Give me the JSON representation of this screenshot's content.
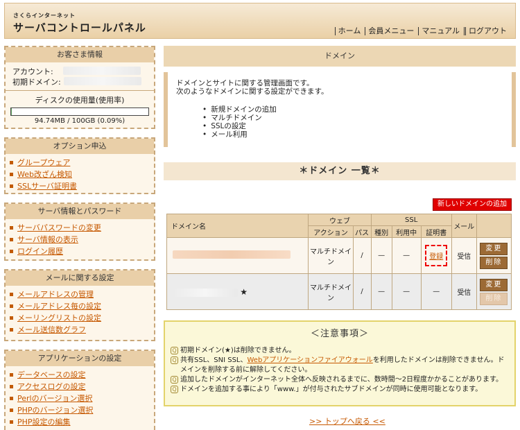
{
  "header": {
    "logo_sub": "さくらインターネット",
    "logo_main": "サーバコントロールパネル",
    "nav": [
      "ホーム",
      "会員メニュー",
      "マニュアル",
      "ログアウト"
    ]
  },
  "sidebar": {
    "customer": {
      "title": "お客さま情報",
      "account_label": "アカウント:",
      "domain_label": "初期ドメイン:",
      "disk_label": "ディスクの使用量(使用率)",
      "disk_value": "94.74MB / 100GB (0.09%)",
      "disk_usage_fraction": 0.0009
    },
    "options": {
      "title": "オプション申込",
      "items": [
        "グループウェア",
        "Web改ざん検知",
        "SSLサーバ証明書"
      ]
    },
    "server": {
      "title": "サーバ情報とパスワード",
      "items": [
        "サーバパスワードの変更",
        "サーバ情報の表示",
        "ログイン履歴"
      ]
    },
    "mail": {
      "title": "メールに関する設定",
      "items": [
        "メールアドレスの管理",
        "メールアドレス毎の設定",
        "メーリングリストの設定",
        "メール送信数グラフ"
      ]
    },
    "apps": {
      "title": "アプリケーションの設定",
      "items": [
        "データベースの設定",
        "アクセスログの設定",
        "Perlのバージョン選択",
        "PHPのバージョン選択",
        "PHP設定の編集"
      ]
    }
  },
  "main": {
    "title": "ドメイン",
    "intro_line1": "ドメインとサイトに関する管理画面です。",
    "intro_line2": "次のようなドメインに関する設定ができます。",
    "features": [
      "新規ドメインの追加",
      "マルチドメイン",
      "SSLの設定",
      "メール利用"
    ],
    "list_title": "＊ドメイン 一覧＊",
    "new_domain_button": "新しいドメインの追加",
    "table": {
      "h_domain": "ドメイン名",
      "h_web": "ウェブ",
      "h_ssl": "SSL",
      "h_mail": "メール",
      "h_action": "アクション",
      "h_path": "パス",
      "h_type": "種別",
      "h_inuse": "利用中",
      "h_cert": "証明書",
      "rows": [
        {
          "action": "マルチドメイン",
          "path": "/",
          "type": "—",
          "inuse": "—",
          "cert": "登録",
          "mail": "受信",
          "star": ""
        },
        {
          "action": "マルチドメイン",
          "path": "/",
          "type": "—",
          "inuse": "—",
          "cert": "—",
          "mail": "受信",
          "star": "★"
        }
      ],
      "edit_label": "変更",
      "delete_label": "削除"
    },
    "notice": {
      "title": "＜注意事項＞",
      "line1": "初期ドメイン(★)は削除できません。",
      "line2_pre": "共有SSL、SNI SSL、",
      "line2_link": "Webアプリケーションファイアウォール",
      "line2_post": "を利用したドメインは削除できません。ドメインを削除する前に解除してください。",
      "line3": "追加したドメインがインターネット全体へ反映されるまでに、数時間～2日程度かかることがあります。",
      "line4": "ドメインを追加する事により「www.」が付与されたサブドメインが同時に使用可能となります。"
    },
    "back_to_top": ">> トップへ戻る <<"
  },
  "colors": {
    "accent": "#c65800",
    "header_bg": "#ead0a6",
    "danger": "#e00000",
    "panel": "#ecd7b4"
  }
}
